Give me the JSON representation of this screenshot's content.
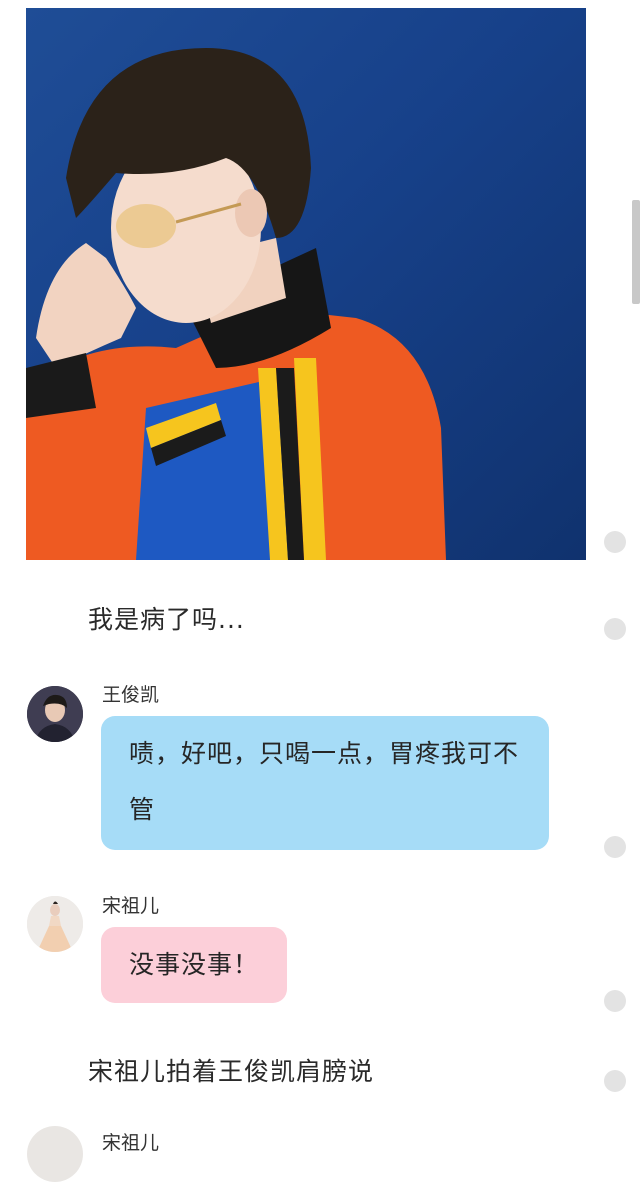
{
  "story": {
    "narration_1": "我是病了吗...",
    "narration_2": "宋祖儿拍着王俊凯肩膀说"
  },
  "messages": [
    {
      "sender": "王俊凯",
      "text": "啧，好吧，只喝一点，胃疼我可不管",
      "bubble_color": "#a6dcf7"
    },
    {
      "sender": "宋祖儿",
      "text": "没事没事！",
      "bubble_color": "#fccfd9"
    }
  ],
  "next_message": {
    "sender": "宋祖儿"
  },
  "icons": {
    "photo": "portrait-photo",
    "avatar_1": "avatar-wang-junkai",
    "avatar_2": "avatar-song-zuer"
  },
  "colors": {
    "background": "#ffffff",
    "blue_bubble": "#a6dcf7",
    "pink_bubble": "#fccfd9",
    "photo_background": "#1a4690"
  }
}
